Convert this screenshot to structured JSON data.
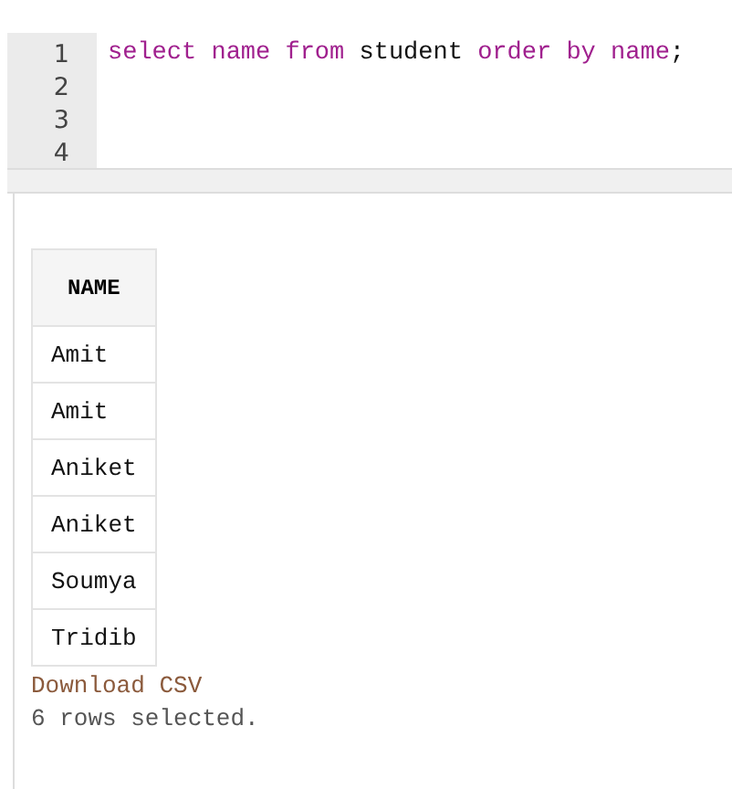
{
  "editor": {
    "lines": [
      {
        "number": "1",
        "tokens": [
          {
            "text": "select",
            "kind": "keyword"
          },
          {
            "text": "name",
            "kind": "keyword"
          },
          {
            "text": "from",
            "kind": "keyword"
          },
          {
            "text": "student",
            "kind": "plain"
          },
          {
            "text": "order",
            "kind": "keyword"
          },
          {
            "text": "by",
            "kind": "keyword"
          },
          {
            "text": "name",
            "kind": "keyword"
          },
          {
            "text": ";",
            "kind": "plain"
          }
        ]
      },
      {
        "number": "2"
      },
      {
        "number": "3"
      },
      {
        "number": "4"
      }
    ]
  },
  "results": {
    "table": {
      "columns": [
        "NAME"
      ],
      "rows": [
        [
          "Amit"
        ],
        [
          "Amit"
        ],
        [
          "Aniket"
        ],
        [
          "Aniket"
        ],
        [
          "Soumya"
        ],
        [
          "Tridib"
        ]
      ]
    },
    "download_link": "Download CSV",
    "status": "6 rows selected."
  }
}
